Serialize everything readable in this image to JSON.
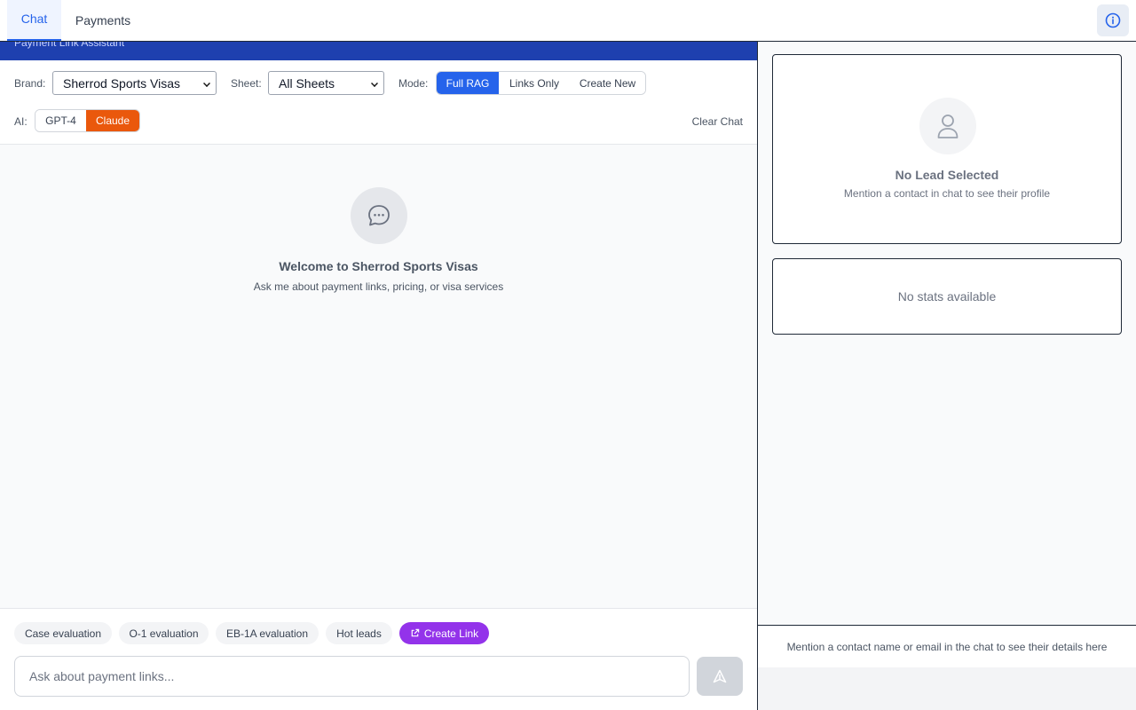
{
  "tabs": {
    "chat": "Chat",
    "payments": "Payments"
  },
  "banner": {
    "subtitle": "Payment Link Assistant"
  },
  "controls": {
    "brand_label": "Brand:",
    "brand_value": "Sherrod Sports Visas",
    "sheet_label": "Sheet:",
    "sheet_value": "All Sheets",
    "mode_label": "Mode:",
    "modes": [
      "Full RAG",
      "Links Only",
      "Create New"
    ],
    "mode_selected": "Full RAG",
    "ai_label": "AI:",
    "ai_options": [
      "GPT-4",
      "Claude"
    ],
    "ai_selected": "Claude",
    "clear_chat": "Clear Chat"
  },
  "welcome": {
    "title": "Welcome to Sherrod Sports Visas",
    "subtitle": "Ask me about payment links, pricing, or visa services"
  },
  "quick_actions": [
    "Case evaluation",
    "O-1 evaluation",
    "EB-1A evaluation",
    "Hot leads"
  ],
  "create_link": "Create Link",
  "composer": {
    "placeholder": "Ask about payment links..."
  },
  "lead_panel": {
    "title": "No Lead Selected",
    "subtitle": "Mention a contact in chat to see their profile"
  },
  "stats_panel": {
    "text": "No stats available"
  },
  "right_footer": "Mention a contact name or email in the chat to see their details here",
  "colors": {
    "primary": "#2563eb",
    "banner": "#1e40af",
    "claude": "#ea580c",
    "create_link": "#9333ea"
  }
}
